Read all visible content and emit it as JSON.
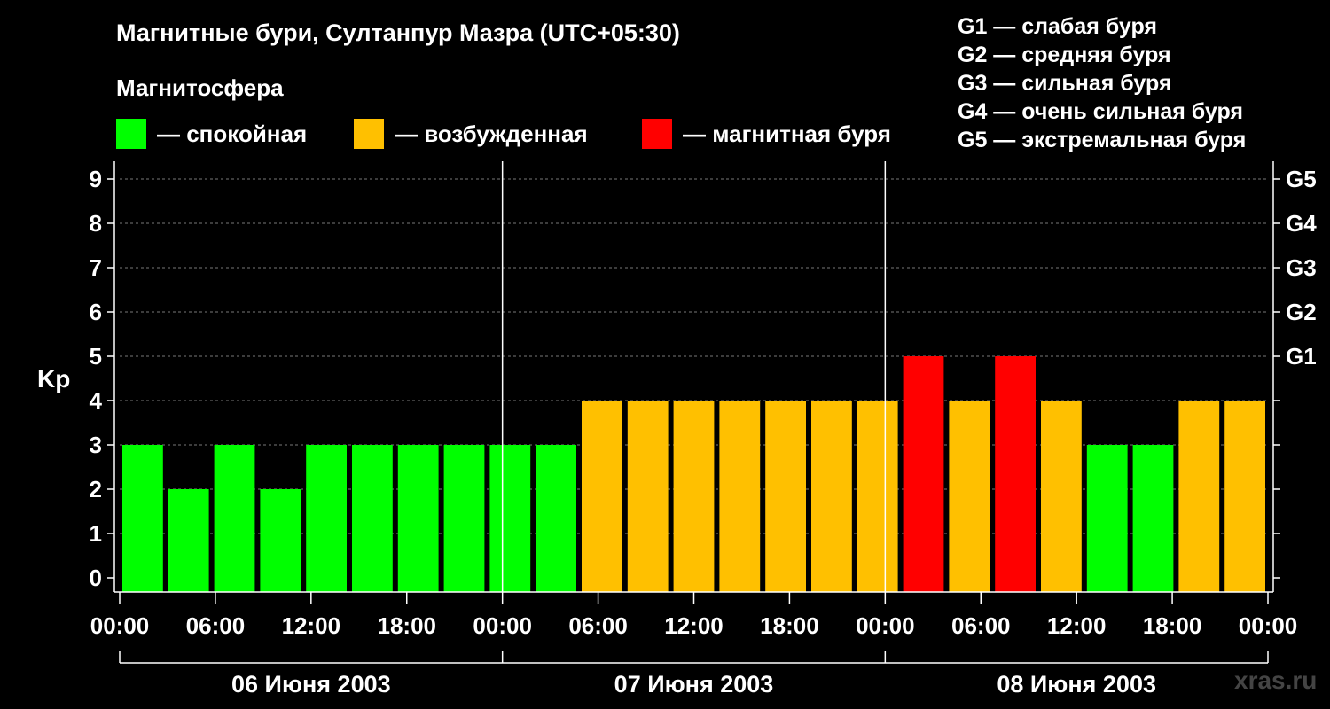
{
  "title": "Магнитные бури, Султанпур Мазра (UTC+05:30)",
  "magnetosphere": {
    "heading": "Магнитосфера",
    "legend": [
      {
        "label": "— спокойная",
        "color": "#00ff00"
      },
      {
        "label": "— возбужденная",
        "color": "#ffc000"
      },
      {
        "label": "— магнитная буря",
        "color": "#ff0000"
      }
    ]
  },
  "g_scale": [
    "G1 — слабая буря",
    "G2 — средняя буря",
    "G3 — сильная буря",
    "G4 — очень сильная буря",
    "G5 — экстремальная буря"
  ],
  "watermark": "xras.ru",
  "chart_data": {
    "type": "bar",
    "ylabel": "Kp",
    "ylim": [
      0,
      9
    ],
    "y_ticks": [
      "0",
      "1",
      "2",
      "3",
      "4",
      "5",
      "6",
      "7",
      "8",
      "9"
    ],
    "right_ticks": [
      {
        "kp": 5,
        "label": "G1"
      },
      {
        "kp": 6,
        "label": "G2"
      },
      {
        "kp": 7,
        "label": "G3"
      },
      {
        "kp": 8,
        "label": "G4"
      },
      {
        "kp": 9,
        "label": "G5"
      }
    ],
    "x_tick_labels": [
      "00:00",
      "06:00",
      "12:00",
      "18:00",
      "00:00",
      "06:00",
      "12:00",
      "18:00",
      "00:00",
      "06:00",
      "12:00",
      "18:00",
      "00:00"
    ],
    "days": [
      "06 Июня 2003",
      "07 Июня 2003",
      "08 Июня 2003"
    ],
    "grid": "dashed horizontal lines at Kp 1–9",
    "colors": {
      "quiet": "#00ff00",
      "active": "#ffc000",
      "storm": "#ff0000"
    },
    "values": [
      3,
      2,
      3,
      2,
      3,
      3,
      3,
      3,
      3,
      3,
      4,
      4,
      4,
      4,
      4,
      4,
      4,
      5,
      4,
      5,
      4,
      3,
      3,
      4,
      4
    ],
    "levels": [
      "quiet",
      "quiet",
      "quiet",
      "quiet",
      "quiet",
      "quiet",
      "quiet",
      "quiet",
      "quiet",
      "quiet",
      "active",
      "active",
      "active",
      "active",
      "active",
      "active",
      "active",
      "storm",
      "active",
      "storm",
      "active",
      "quiet",
      "quiet",
      "active",
      "active"
    ]
  }
}
